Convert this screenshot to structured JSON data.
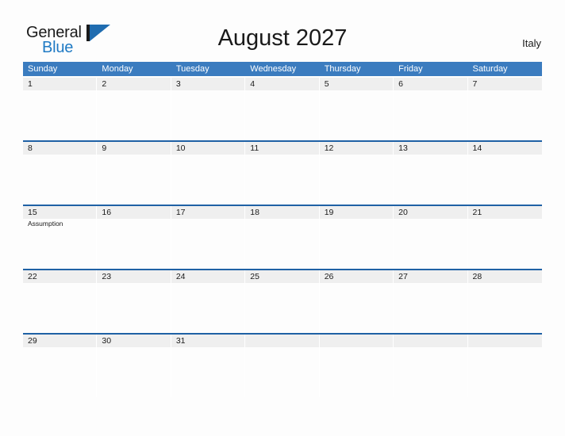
{
  "brand": {
    "word_one": "General",
    "word_two": "Blue",
    "logo_icon": "general-blue-triangle-logo",
    "primary_color": "#1f7ac4",
    "dark_color": "#1a1a1a"
  },
  "header": {
    "title": "August 2027",
    "country": "Italy"
  },
  "calendar": {
    "header_bg": "#3b7cbf",
    "band_bg": "#efefef",
    "separator_color": "#1f61a5",
    "weekdays": [
      "Sunday",
      "Monday",
      "Tuesday",
      "Wednesday",
      "Thursday",
      "Friday",
      "Saturday"
    ],
    "weeks": [
      [
        {
          "day": "1",
          "events": []
        },
        {
          "day": "2",
          "events": []
        },
        {
          "day": "3",
          "events": []
        },
        {
          "day": "4",
          "events": []
        },
        {
          "day": "5",
          "events": []
        },
        {
          "day": "6",
          "events": []
        },
        {
          "day": "7",
          "events": []
        }
      ],
      [
        {
          "day": "8",
          "events": []
        },
        {
          "day": "9",
          "events": []
        },
        {
          "day": "10",
          "events": []
        },
        {
          "day": "11",
          "events": []
        },
        {
          "day": "12",
          "events": []
        },
        {
          "day": "13",
          "events": []
        },
        {
          "day": "14",
          "events": []
        }
      ],
      [
        {
          "day": "15",
          "events": [
            "Assumption"
          ]
        },
        {
          "day": "16",
          "events": []
        },
        {
          "day": "17",
          "events": []
        },
        {
          "day": "18",
          "events": []
        },
        {
          "day": "19",
          "events": []
        },
        {
          "day": "20",
          "events": []
        },
        {
          "day": "21",
          "events": []
        }
      ],
      [
        {
          "day": "22",
          "events": []
        },
        {
          "day": "23",
          "events": []
        },
        {
          "day": "24",
          "events": []
        },
        {
          "day": "25",
          "events": []
        },
        {
          "day": "26",
          "events": []
        },
        {
          "day": "27",
          "events": []
        },
        {
          "day": "28",
          "events": []
        }
      ],
      [
        {
          "day": "29",
          "events": []
        },
        {
          "day": "30",
          "events": []
        },
        {
          "day": "31",
          "events": []
        },
        {
          "day": "",
          "events": []
        },
        {
          "day": "",
          "events": []
        },
        {
          "day": "",
          "events": []
        },
        {
          "day": "",
          "events": []
        }
      ]
    ]
  }
}
